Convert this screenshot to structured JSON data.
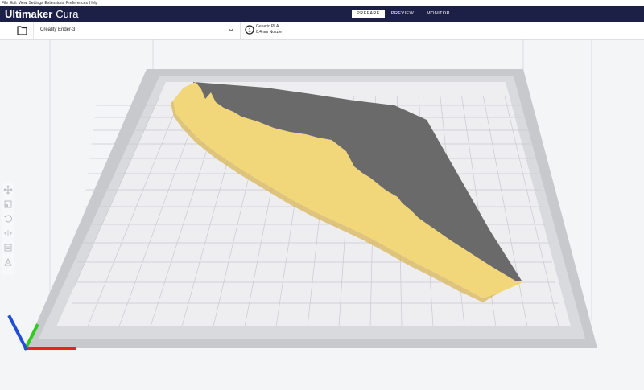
{
  "menu": {
    "items": [
      "File",
      "Edit",
      "View",
      "Settings",
      "Extensions",
      "Preferences",
      "Help"
    ]
  },
  "header": {
    "brand_bold": "Ultimaker",
    "brand_light": "Cura",
    "tabs": [
      {
        "label": "PREPARE",
        "active": true
      },
      {
        "label": "PREVIEW",
        "active": false
      },
      {
        "label": "MONITOR",
        "active": false
      }
    ],
    "bar_color": "#1d2046"
  },
  "stage": {
    "printer": "Creality Ender-3",
    "material_name": "Generic PLA",
    "nozzle": "0.4mm Nozzle"
  },
  "toolbar": {
    "tools": [
      "move-icon",
      "scale-icon",
      "rotate-icon",
      "mirror-icon",
      "per-model-settings-icon",
      "support-blocker-icon"
    ]
  },
  "scene": {
    "model_color": "#f2d67a",
    "overhang_color": "#6a6a6a",
    "plate_color": "#ececee",
    "disallowed_border_color": "#c7c8cc",
    "axes": {
      "x_color": "#e8241a",
      "y_color": "#2ecc1f",
      "z_color": "#1e4fd6"
    }
  }
}
